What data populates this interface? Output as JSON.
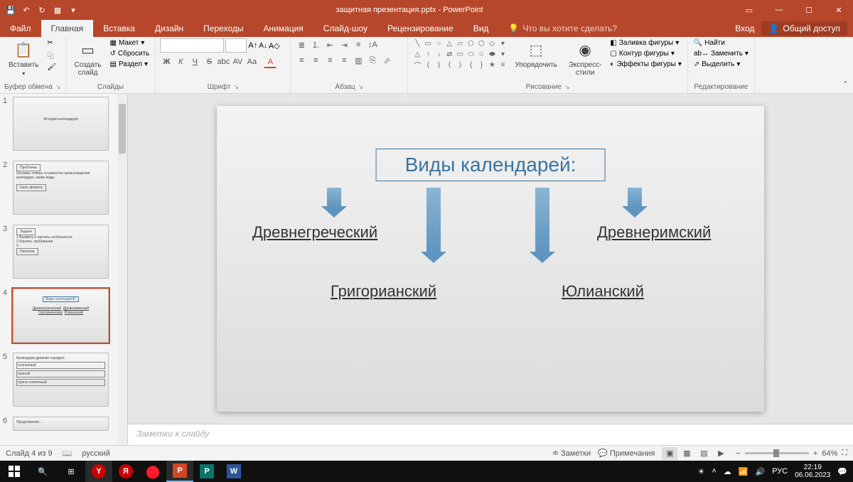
{
  "title": "защитная презентация.pptx - PowerPoint",
  "qat": {
    "save": "💾",
    "undo": "↶",
    "redo": "↻",
    "start": "▦"
  },
  "tabs": {
    "file": "Файл",
    "home": "Главная",
    "insert": "Вставка",
    "design": "Дизайн",
    "transitions": "Переходы",
    "animations": "Анимация",
    "slideshow": "Слайд-шоу",
    "review": "Рецензирование",
    "view": "Вид",
    "tell": "Что вы хотите сделать?",
    "signin": "Вход",
    "share": "Общий доступ"
  },
  "ribbon": {
    "clipboard": {
      "label": "Буфер обмена",
      "paste": "Вставить"
    },
    "slides": {
      "label": "Слайды",
      "new": "Создать\nслайд",
      "layout": "Макет",
      "reset": "Сбросить",
      "section": "Раздел"
    },
    "font": {
      "label": "Шрифт",
      "bold": "Ж",
      "italic": "К",
      "underline": "Ч",
      "strike": "S",
      "shadow": "abc",
      "spacing": "AV",
      "case": "Aa",
      "clear": "A"
    },
    "paragraph": {
      "label": "Абзац"
    },
    "drawing": {
      "label": "Рисование",
      "arrange": "Упорядочить",
      "styles": "Экспресс-\nстили",
      "fill": "Заливка фигуры",
      "outline": "Контур фигуры",
      "effects": "Эффекты фигуры"
    },
    "editing": {
      "label": "Редактирование",
      "find": "Найти",
      "replace": "Заменить",
      "select": "Выделить"
    }
  },
  "slide": {
    "title": "Виды календарей:",
    "l1": "Древнегреческий",
    "l2": "Древнеримский",
    "l3": "Григорианский",
    "l4": "Юлианский"
  },
  "thumbs": {
    "t1": "1",
    "t2": "2",
    "t3": "3",
    "t4": "4",
    "t5": "5",
    "t6": "6"
  },
  "notes": "Заметки к слайду",
  "status": {
    "slide": "Слайд 4 из 9",
    "lang": "русский",
    "notes": "Заметки",
    "comments": "Примечания",
    "zoom": "64%"
  },
  "taskbar": {
    "lang": "РУС",
    "time": "22:19",
    "date": "06.06.2023"
  }
}
